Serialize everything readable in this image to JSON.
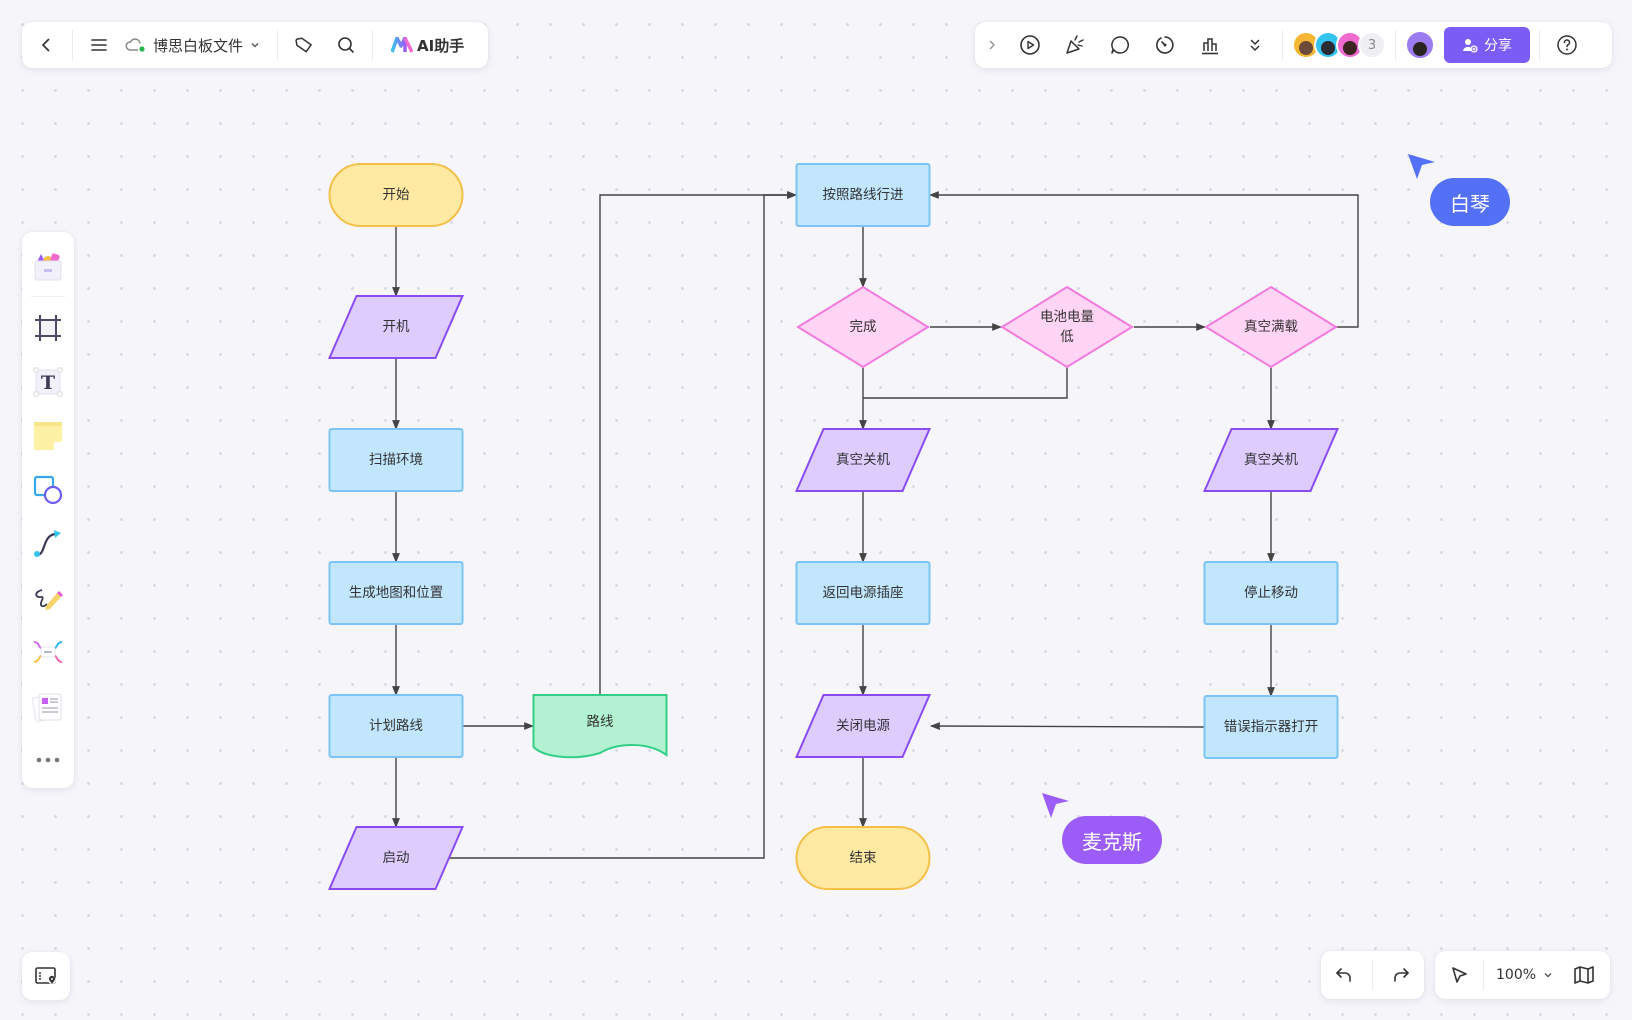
{
  "toolbar_top_left": {
    "back_icon": "chevron-left-icon",
    "menu_icon": "hamburger-icon",
    "file_name": "博思白板文件",
    "sync_status_icon": "cloud-synced-icon",
    "tag_icon": "tag-icon",
    "search_icon": "search-icon",
    "ai_label": "AI助手"
  },
  "toolbar_top_right": {
    "icons": [
      "expand-chevron-icon",
      "play-icon",
      "celebrate-icon",
      "comment-icon",
      "timer-icon",
      "vote-icon",
      "more-chevrons-icon"
    ],
    "collaborators": [
      {
        "color": "#f5b731"
      },
      {
        "color": "#35c4f0"
      },
      {
        "color": "#f06bd0"
      }
    ],
    "extra_collaborators": "3",
    "share_label": "分享",
    "help_icon": "help-icon"
  },
  "left_toolbar": {
    "tools": [
      "template-icon",
      "frame-icon",
      "text-icon",
      "sticky-note-icon",
      "shape-icon",
      "connector-icon",
      "pen-icon",
      "mindmap-icon",
      "page-icon",
      "more-icon"
    ]
  },
  "bottom_right": {
    "undo_icon": "undo-icon",
    "redo_icon": "redo-icon",
    "select_icon": "pointer-icon",
    "zoom_level": "100%",
    "map_icon": "minimap-icon"
  },
  "bottom_left": {
    "icon": "outline-icon"
  },
  "cursors": [
    {
      "name": "白琴",
      "color": "#5470f7"
    },
    {
      "name": "麦克斯",
      "color": "#9c5cf7"
    }
  ],
  "colors": {
    "terminal_fill": "#ffe9a3",
    "terminal_stroke": "#f5c04a",
    "io_fill": "#dfccff",
    "io_stroke": "#8a4cf2",
    "process_fill": "#c1e6fd",
    "process_stroke": "#7cc4f5",
    "decision_fill": "#ffd4f5",
    "decision_stroke": "#f57bdc",
    "document_fill": "#b2f1d1",
    "document_stroke": "#35d088",
    "edge": "#444444"
  },
  "flowchart": {
    "nodes": [
      {
        "id": "start",
        "label": "开始",
        "type": "terminal"
      },
      {
        "id": "poweron",
        "label": "开机",
        "type": "io"
      },
      {
        "id": "scan",
        "label": "扫描环境",
        "type": "process"
      },
      {
        "id": "map",
        "label": "生成地图和位置",
        "type": "process"
      },
      {
        "id": "plan",
        "label": "计划路线",
        "type": "process"
      },
      {
        "id": "route",
        "label": "路线",
        "type": "document"
      },
      {
        "id": "launch",
        "label": "启动",
        "type": "io"
      },
      {
        "id": "follow",
        "label": "按照路线行进",
        "type": "process"
      },
      {
        "id": "done",
        "label": "完成",
        "type": "decision"
      },
      {
        "id": "battery",
        "label": "电池电量低",
        "label_lines": [
          "电池电量",
          "低"
        ],
        "type": "decision"
      },
      {
        "id": "full",
        "label": "真空满载",
        "type": "decision"
      },
      {
        "id": "vacoff1",
        "label": "真空关机",
        "type": "io"
      },
      {
        "id": "return",
        "label": "返回电源插座",
        "type": "process"
      },
      {
        "id": "poweroff",
        "label": "关闭电源",
        "type": "io"
      },
      {
        "id": "end",
        "label": "结束",
        "type": "terminal"
      },
      {
        "id": "vacoff2",
        "label": "真空关机",
        "type": "io"
      },
      {
        "id": "stop",
        "label": "停止移动",
        "type": "process"
      },
      {
        "id": "error",
        "label": "错误指示器打开",
        "type": "process"
      }
    ],
    "edges": [
      [
        "start",
        "poweron"
      ],
      [
        "poweron",
        "scan"
      ],
      [
        "scan",
        "map"
      ],
      [
        "map",
        "plan"
      ],
      [
        "plan",
        "route"
      ],
      [
        "plan",
        "launch"
      ],
      [
        "route",
        "follow"
      ],
      [
        "launch",
        "follow"
      ],
      [
        "follow",
        "done"
      ],
      [
        "done",
        "battery"
      ],
      [
        "battery",
        "full"
      ],
      [
        "full",
        "follow"
      ],
      [
        "done",
        "vacoff1"
      ],
      [
        "battery",
        "vacoff1"
      ],
      [
        "vacoff1",
        "return"
      ],
      [
        "return",
        "poweroff"
      ],
      [
        "poweroff",
        "end"
      ],
      [
        "full",
        "vacoff2"
      ],
      [
        "vacoff2",
        "stop"
      ],
      [
        "stop",
        "error"
      ],
      [
        "error",
        "poweroff"
      ]
    ]
  }
}
